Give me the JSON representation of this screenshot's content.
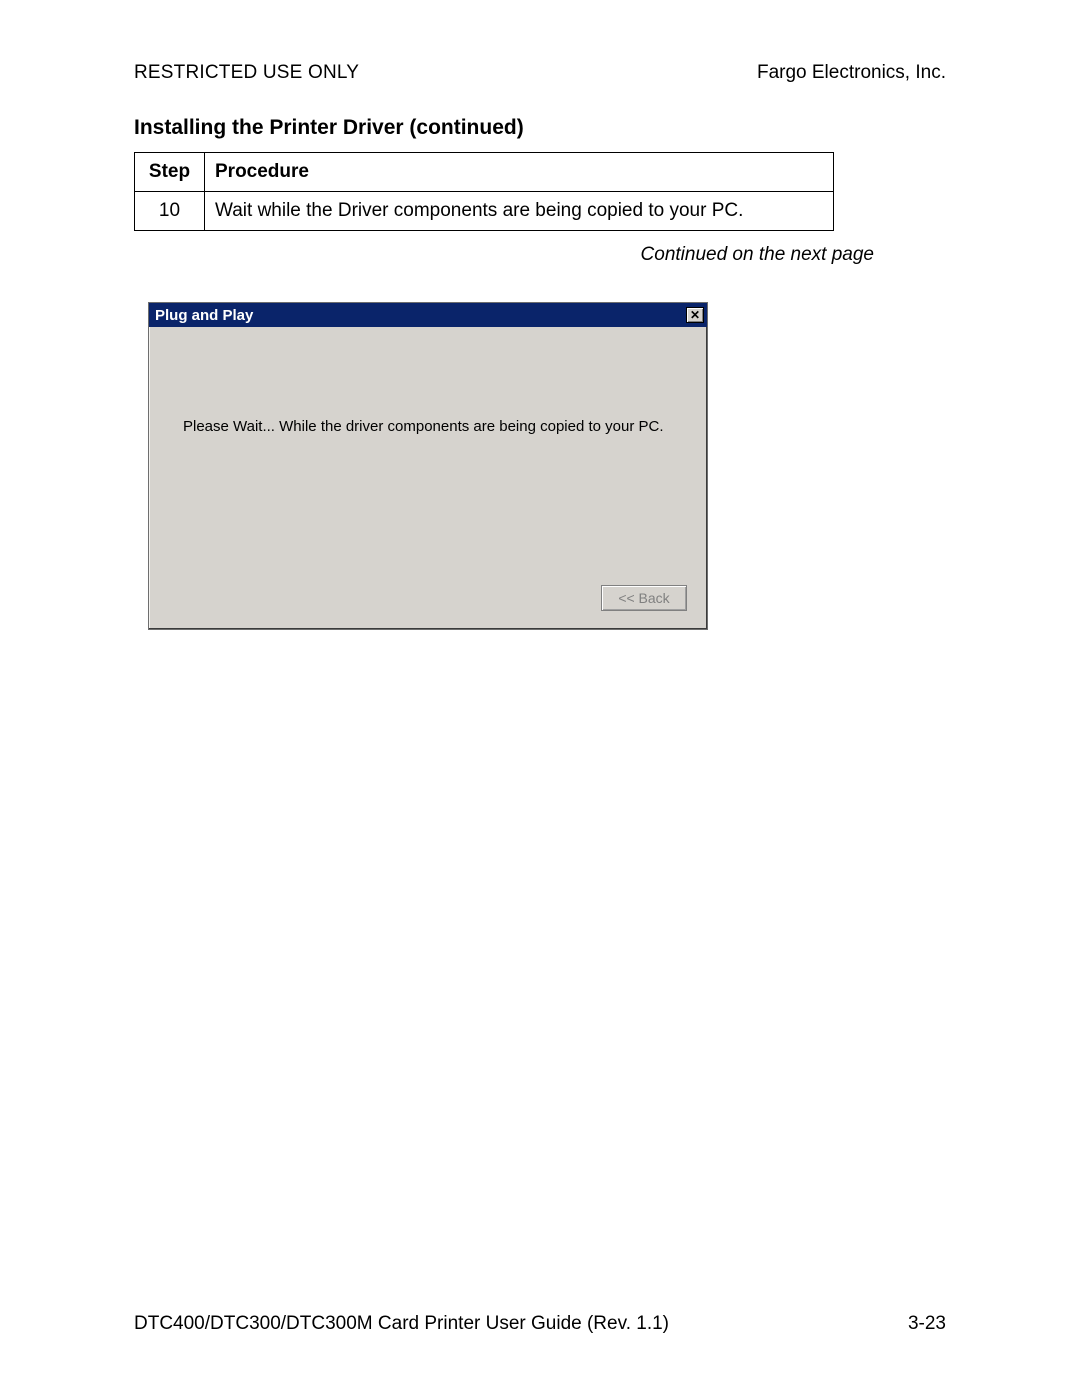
{
  "header": {
    "left": "RESTRICTED USE ONLY",
    "right": "Fargo Electronics, Inc."
  },
  "section_title": "Installing the Printer Driver (continued)",
  "table": {
    "headers": {
      "step": "Step",
      "procedure": "Procedure"
    },
    "rows": [
      {
        "step": "10",
        "procedure": "Wait while the Driver components are being copied to your PC."
      }
    ]
  },
  "continuation_note": "Continued on the next page",
  "dialog": {
    "title": "Plug and Play",
    "close_glyph": "✕",
    "message": "Please Wait... While the driver components are being copied to your PC.",
    "back_label": "<< Back"
  },
  "footer": {
    "left": "DTC400/DTC300/DTC300M Card Printer User Guide (Rev. 1.1)",
    "right": "3-23"
  }
}
